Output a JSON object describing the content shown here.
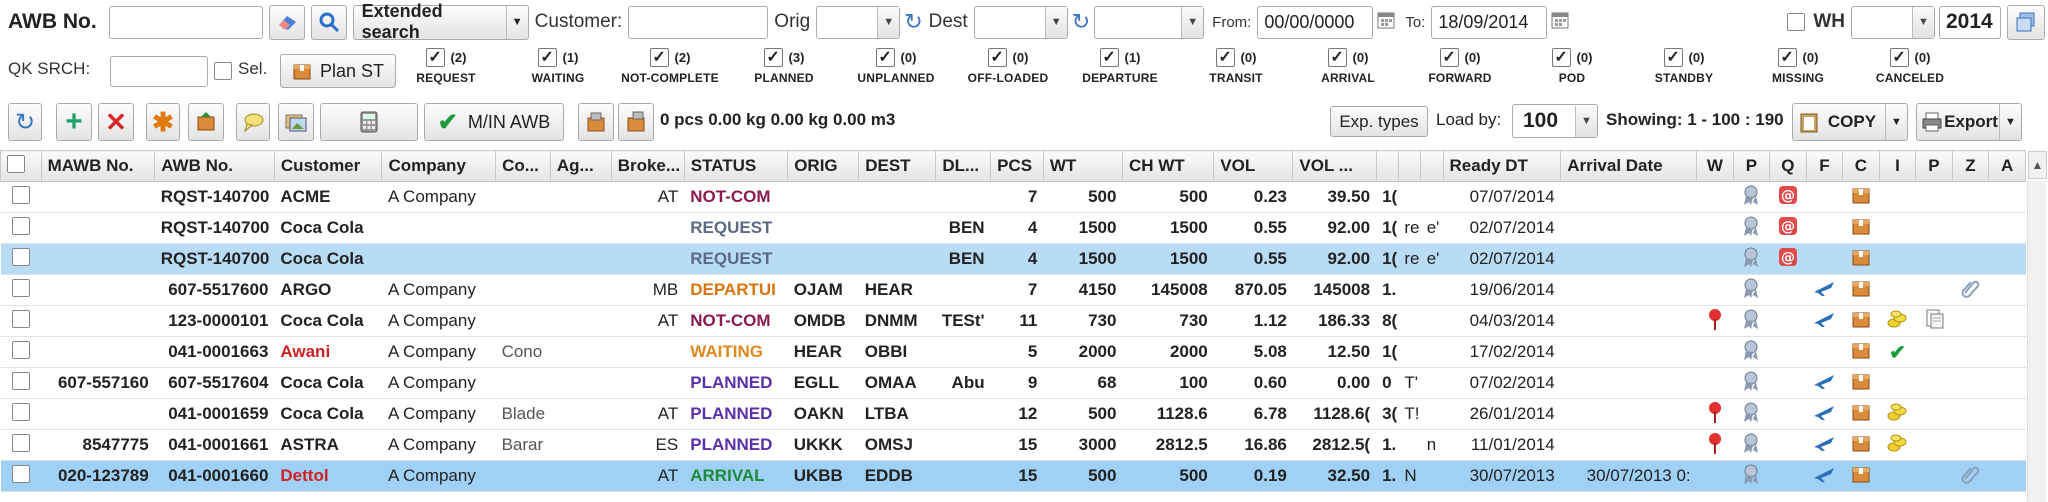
{
  "row1": {
    "awb_label": "AWB No.",
    "search_btn": "Extended search",
    "customer_label": "Customer:",
    "orig_label": "Orig",
    "dest_label": "Dest",
    "from_label": "From:",
    "from_value": "00/00/0000",
    "to_label": "To:",
    "to_value": "18/09/2014",
    "wh_label": "WH",
    "year_value": "2014"
  },
  "row2": {
    "qk_label": "QK SRCH:",
    "sel_label": "Sel.",
    "plan_btn": "Plan ST",
    "statuses": [
      {
        "count": "(2)",
        "name": "REQUEST",
        "checked": true
      },
      {
        "count": "(1)",
        "name": "WAITING",
        "checked": true
      },
      {
        "count": "(2)",
        "name": "NOT-COMPLETE",
        "checked": true
      },
      {
        "count": "(3)",
        "name": "PLANNED",
        "checked": true
      },
      {
        "count": "(0)",
        "name": "UNPLANNED",
        "checked": true
      },
      {
        "count": "(0)",
        "name": "OFF-LOADED",
        "checked": true
      },
      {
        "count": "(1)",
        "name": "DEPARTURE",
        "checked": true
      },
      {
        "count": "(0)",
        "name": "TRANSIT",
        "checked": true
      },
      {
        "count": "(0)",
        "name": "ARRIVAL",
        "checked": true
      },
      {
        "count": "(0)",
        "name": "FORWARD",
        "checked": true
      },
      {
        "count": "(0)",
        "name": "POD",
        "checked": true
      },
      {
        "count": "(0)",
        "name": "STANDBY",
        "checked": true
      },
      {
        "count": "(0)",
        "name": "MISSING",
        "checked": true
      },
      {
        "count": "(0)",
        "name": "CANCELED",
        "checked": true
      }
    ]
  },
  "toolbar": {
    "min_awb": "M/IN AWB",
    "totals": "0 pcs 0.00 kg 0.00 kg 0.00 m3",
    "exp_types": "Exp. types",
    "load_by_label": "Load by:",
    "load_by_value": "100",
    "showing": "Showing: 1 - 100 : 190",
    "copy": "COPY",
    "export": "Export"
  },
  "columns": [
    "MAWB No.",
    "AWB No.",
    "Customer",
    "Company",
    "Co...",
    "Ag...",
    "Broke...",
    "STATUS",
    "ORIG",
    "DEST",
    "DL...",
    "PCS",
    "WT",
    "CH WT",
    "VOL",
    "VOL ...",
    "",
    "",
    "",
    "Ready DT",
    "Arrival Date",
    "W",
    "P",
    "Q",
    "F",
    "C",
    "I",
    "P",
    "Z",
    "A"
  ],
  "rows": [
    {
      "mawb": "",
      "awb": "RQST-140700",
      "customer": "ACME",
      "cust_color": "#222",
      "company": "A Company",
      "co": "",
      "ag": "",
      "broker": "AT",
      "status": "NOT-COM",
      "status_color": "#8b1a52",
      "orig": "",
      "dest": "",
      "dl": "",
      "pcs": "7",
      "wt": "500",
      "chwt": "500",
      "vol": "0.23",
      "vol2": "39.50",
      "x1": "1(",
      "x2": "",
      "x3": "",
      "ready": "07/07/2014",
      "arrival": "",
      "flags": "p,q,c"
    },
    {
      "mawb": "",
      "awb": "RQST-140700",
      "customer": "Coca Cola",
      "cust_color": "#222",
      "company": "",
      "co": "",
      "ag": "",
      "broker": "",
      "status": "REQUEST",
      "status_color": "#5a6a82",
      "orig": "",
      "dest": "",
      "dl": "BEN",
      "pcs": "4",
      "wt": "1500",
      "chwt": "1500",
      "vol": "0.55",
      "vol2": "92.00",
      "x1": "1(",
      "x2": "re",
      "x3": "e'",
      "ready": "02/07/2014",
      "arrival": "",
      "flags": "p,q,c"
    },
    {
      "mawb": "",
      "awb": "RQST-140700",
      "customer": "Coca Cola",
      "cust_color": "#222",
      "company": "",
      "co": "",
      "ag": "",
      "broker": "",
      "status": "REQUEST",
      "status_color": "#5a6a82",
      "orig": "",
      "dest": "",
      "dl": "BEN",
      "pcs": "4",
      "wt": "1500",
      "chwt": "1500",
      "vol": "0.55",
      "vol2": "92.00",
      "x1": "1(",
      "x2": "re",
      "x3": "e'",
      "ready": "02/07/2014",
      "arrival": "",
      "flags": "p,q,c"
    },
    {
      "mawb": "",
      "awb": "607-5517600",
      "customer": "ARGO",
      "cust_color": "#222",
      "company": "A Company",
      "co": "",
      "ag": "",
      "broker": "MB",
      "status": "DEPARTUI",
      "status_color": "#d9740b",
      "orig": "OJAM",
      "dest": "HEAR",
      "dl": "",
      "pcs": "7",
      "wt": "4150",
      "chwt": "145008",
      "vol": "870.05",
      "vol2": "145008",
      "x1": "1.",
      "x2": "",
      "x3": "",
      "ready": "19/06/2014",
      "arrival": "",
      "flags": "p,f,c,z"
    },
    {
      "mawb": "",
      "awb": "123-0000101",
      "customer": "Coca Cola",
      "cust_color": "#222",
      "company": "A Company",
      "co": "",
      "ag": "",
      "broker": "AT",
      "status": "NOT-COM",
      "status_color": "#8b1a52",
      "orig": "OMDB",
      "dest": "DNMM",
      "dl": "TESt'",
      "pcs": "11",
      "wt": "730",
      "chwt": "730",
      "vol": "1.12",
      "vol2": "186.33",
      "x1": "8(",
      "x2": "",
      "x3": "",
      "ready": "04/03/2014",
      "arrival": "",
      "flags": "w,p,f,c,i,doc"
    },
    {
      "mawb": "",
      "awb": "041-0001663",
      "customer": "Awani",
      "cust_color": "#d02020",
      "company": "A Company",
      "co": "Cono",
      "ag": "",
      "broker": "",
      "status": "WAITING",
      "status_color": "#e0871e",
      "orig": "HEAR",
      "dest": "OBBI",
      "dl": "",
      "pcs": "5",
      "wt": "2000",
      "chwt": "2000",
      "vol": "5.08",
      "vol2": "12.50",
      "x1": "1(",
      "x2": "",
      "x3": "",
      "ready": "17/02/2014",
      "arrival": "",
      "flags": "p,c,check"
    },
    {
      "mawb": "607-557160",
      "awb": "607-5517604",
      "customer": "Coca Cola",
      "cust_color": "#222",
      "company": "A Company",
      "co": "",
      "ag": "",
      "broker": "",
      "status": "PLANNED",
      "status_color": "#5b2fa8",
      "orig": "EGLL",
      "dest": "OMAA",
      "dl": "Abu",
      "pcs": "9",
      "wt": "68",
      "chwt": "100",
      "vol": "0.60",
      "vol2": "0.00",
      "x1": "0",
      "x2": "T'",
      "x3": "",
      "ready": "07/02/2014",
      "arrival": "",
      "flags": "p,f,c"
    },
    {
      "mawb": "",
      "awb": "041-0001659",
      "customer": "Coca Cola",
      "cust_color": "#222",
      "company": "A Company",
      "co": "Blade",
      "ag": "",
      "broker": "AT",
      "status": "PLANNED",
      "status_color": "#5b2fa8",
      "orig": "OAKN",
      "dest": "LTBA",
      "dl": "",
      "pcs": "12",
      "wt": "500",
      "chwt": "1128.6",
      "vol": "6.78",
      "vol2": "1128.6(",
      "x1": "3(",
      "x2": "T!",
      "x3": "",
      "ready": "26/01/2014",
      "arrival": "",
      "flags": "w,p,f,c,i"
    },
    {
      "mawb": "8547775",
      "awb": "041-0001661",
      "customer": "ASTRA",
      "cust_color": "#222",
      "company": "A Company",
      "co": "Barar",
      "ag": "",
      "broker": "ES",
      "status": "PLANNED",
      "status_color": "#5b2fa8",
      "orig": "UKKK",
      "dest": "OMSJ",
      "dl": "",
      "pcs": "15",
      "wt": "3000",
      "chwt": "2812.5",
      "vol": "16.86",
      "vol2": "2812.5(",
      "x1": "1.",
      "x2": "",
      "x3": "n",
      "ready": "11/01/2014",
      "arrival": "",
      "flags": "w,p,f,c,i"
    },
    {
      "mawb": "020-123789",
      "awb": "041-0001660",
      "customer": "Dettol",
      "cust_color": "#d02020",
      "company": "A Company",
      "co": "",
      "ag": "",
      "broker": "AT",
      "status": "ARRIVAL",
      "status_color": "#1e8a3a",
      "orig": "UKBB",
      "dest": "EDDB",
      "dl": "",
      "pcs": "15",
      "wt": "500",
      "chwt": "500",
      "vol": "0.19",
      "vol2": "32.50",
      "x1": "1.",
      "x2": "N",
      "x3": "",
      "ready": "30/07/2013",
      "arrival": "30/07/2013 0:",
      "flags": "p,f,c,z"
    }
  ]
}
